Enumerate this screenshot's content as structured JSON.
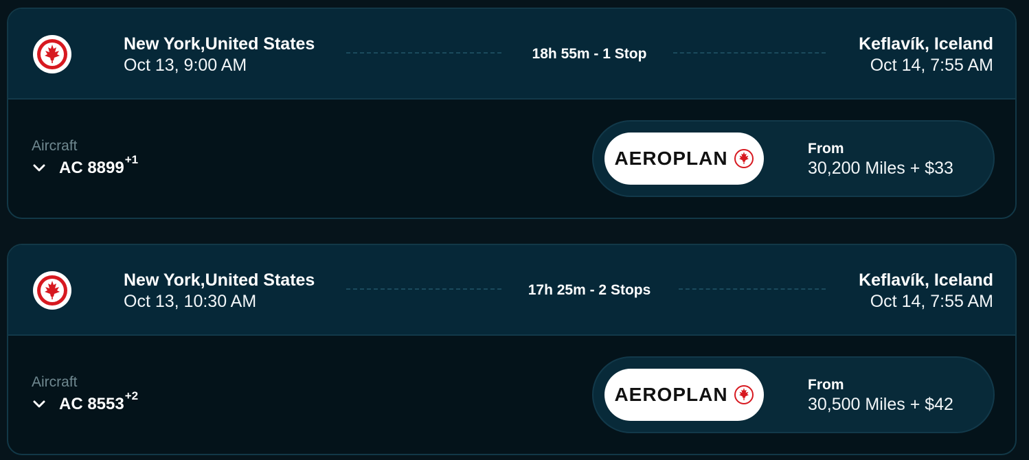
{
  "colors": {
    "accent": "#d71920",
    "card_header": "#062838",
    "card_body": "#04131a",
    "muted": "#6f8890"
  },
  "flights": [
    {
      "origin_city": "New York,United States",
      "origin_time": "Oct 13, 9:00 AM",
      "duration": "18h 55m - 1 Stop",
      "dest_city": "Keflavík, Iceland",
      "dest_time": "Oct 14, 7:55 AM",
      "aircraft_label": "Aircraft",
      "flight_number": "AC 8899",
      "extra_flights": "+1",
      "program_name": "AEROPLAN",
      "price_label": "From",
      "price": "30,200 Miles + $33"
    },
    {
      "origin_city": "New York,United States",
      "origin_time": "Oct 13, 10:30 AM",
      "duration": "17h 25m - 2 Stops",
      "dest_city": "Keflavík, Iceland",
      "dest_time": "Oct 14, 7:55 AM",
      "aircraft_label": "Aircraft",
      "flight_number": "AC 8553",
      "extra_flights": "+2",
      "program_name": "AEROPLAN",
      "price_label": "From",
      "price": "30,500 Miles + $42"
    }
  ],
  "icons": {
    "airline_logo": "air-canada-maple-leaf-icon",
    "expand": "chevron-down-icon",
    "program_logo": "maple-leaf-icon"
  }
}
